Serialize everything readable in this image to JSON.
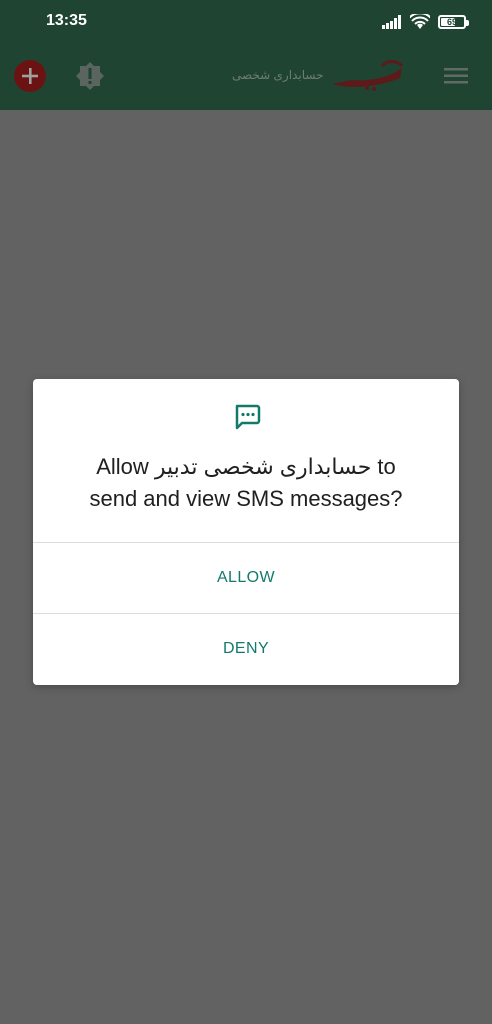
{
  "status_bar": {
    "time": "13:35",
    "battery": "69",
    "icons": [
      "signal-icon",
      "wifi-icon",
      "battery-icon"
    ]
  },
  "app_bar": {
    "app_name": "حسابداری شخصی",
    "logo_text": "تدبیر",
    "icons": [
      "add-icon",
      "alert-icon",
      "menu-icon"
    ]
  },
  "dialog": {
    "icon": "sms-icon",
    "title_line1": "Allow حسابداری شخصی تدبیر to",
    "title_line2": "send and view SMS messages?",
    "allow_label": "ALLOW",
    "deny_label": "DENY"
  },
  "colors": {
    "app_bar": "#1f4432",
    "scrim": "#626262",
    "accent": "#137a6b",
    "add_button": "#6b1313"
  }
}
